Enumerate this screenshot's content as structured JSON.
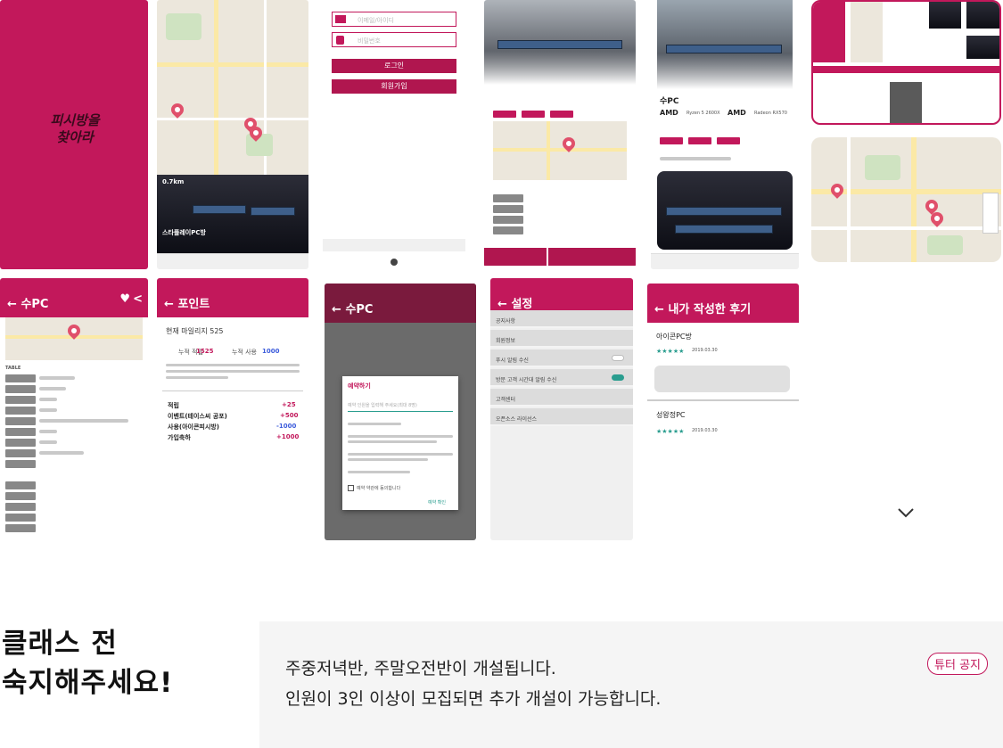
{
  "gallery": {
    "splash": {
      "title": "피시방을 찾아라"
    },
    "screens": {
      "map_card": {
        "distance": "0.7km",
        "pc_name": "스타플레이PC방"
      },
      "login": {
        "email_placeholder": "이메일/아이디",
        "password_placeholder": "비밀번호",
        "login_button": "로그인",
        "signup_button": "회원가입"
      },
      "detail_card": {
        "name": "수PC",
        "cpu_brand_1": "AMD",
        "cpu_model_1": "Ryzen 5 2600X",
        "cpu_brand_2": "AMD",
        "cpu_model_2": "Radeon RX570"
      },
      "detail": {
        "header": "수PC",
        "specs_title": "TABLE"
      },
      "points": {
        "header": "포인트",
        "current_label": "현재 마일리지 525",
        "earned_label": "누적 적립",
        "earned_value": "1525",
        "used_label": "누적 사용",
        "used_value": "1000",
        "rows": [
          {
            "label": "적립",
            "value": "+25"
          },
          {
            "label": "이벤트(테이스씨 공포)",
            "value": "+500"
          },
          {
            "label": "사용(아이콘피시방)",
            "value": "-1000"
          },
          {
            "label": "가입축하",
            "value": "+1000"
          }
        ]
      },
      "reserve": {
        "header": "수PC",
        "dialog_title": "예약하기",
        "dialog_placeholder": "예약 인원을 입력해 주세요(최대 8명)",
        "checkbox_label": "예약 약관에 동의합니다",
        "confirm": "예약 확인"
      },
      "settings": {
        "header": "설정",
        "items": [
          "공지사항",
          "회원정보",
          "푸시 알림 수신",
          "방문 고객 시간대 알림 수신",
          "고객센터",
          "오픈소스 라이선스"
        ]
      },
      "reviews": {
        "header": "내가 작성한 후기",
        "items": [
          {
            "name": "아이콘PC방",
            "date": "2019.03.30"
          },
          {
            "name": "성왕정PC",
            "date": "2019.03.30"
          }
        ]
      }
    }
  },
  "notice": {
    "title_line1": "클래스 전",
    "title_line2": "숙지해주세요!",
    "line1": "주중저녁반, 주말오전반이 개설됩니다.",
    "line2": "인원이 3인 이상이 모집되면 추가 개설이 가능합니다.",
    "badge": "튜터 공지"
  },
  "colors": {
    "brand": "#c2185b",
    "box_bg": "#f5f5f5"
  }
}
